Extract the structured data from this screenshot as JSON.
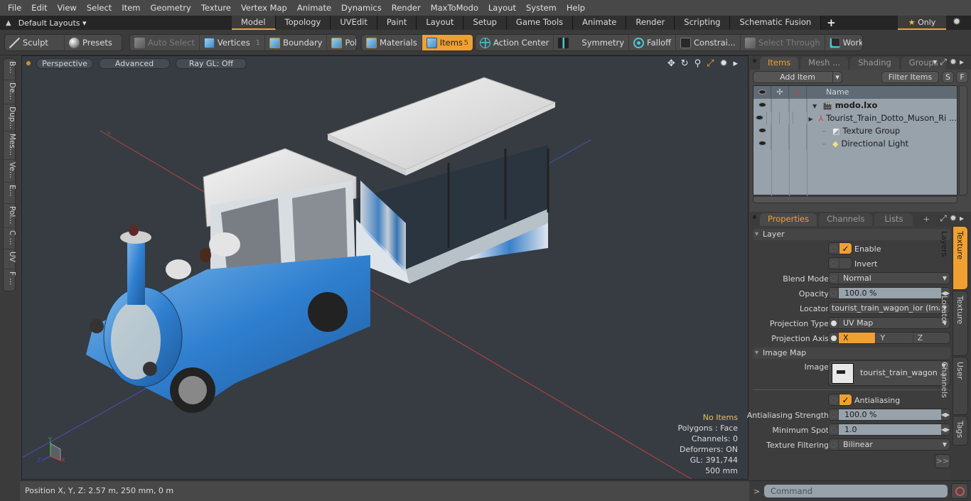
{
  "menu": [
    "File",
    "Edit",
    "View",
    "Select",
    "Item",
    "Geometry",
    "Texture",
    "Vertex Map",
    "Animate",
    "Dynamics",
    "Render",
    "MaxToModo",
    "Layout",
    "System",
    "Help"
  ],
  "layouts": {
    "dropdown_label": "Default Layouts ▾",
    "tabs": [
      "Model",
      "Topology",
      "UVEdit",
      "Paint",
      "Layout",
      "Setup",
      "Game Tools",
      "Animate",
      "Render",
      "Scripting",
      "Schematic Fusion"
    ],
    "active_tab": "Model",
    "add_tab_label": "+",
    "only_label": "Only"
  },
  "toolbar": {
    "sculpt": "Sculpt",
    "presets": "Presets",
    "auto_select": "Auto Select",
    "vertices": "Vertices",
    "vertices_count": "1",
    "boundary": "Boundary",
    "polygons": "Polygons",
    "materials": "Materials",
    "items": "Items",
    "items_count": "5",
    "action_center": "Action Center",
    "symmetry": "Symmetry",
    "falloff": "Falloff",
    "constraints": "Constrai...",
    "select_through": "Select Through",
    "workplane": "WorkPlane"
  },
  "left_tools": [
    "B...",
    "De...",
    "Dup...",
    "Mes...",
    "Ve...",
    "E...",
    "Pol...",
    "C ...",
    "UV",
    "F ..."
  ],
  "viewport": {
    "view_mode": "Perspective",
    "shading": "Advanced",
    "raygl": "Ray GL: Off",
    "info": {
      "selection": "No Items",
      "polygons": "Polygons : Face",
      "channels": "Channels: 0",
      "deformers": "Deformers: ON",
      "gl": "GL: 391,744",
      "scale": "500 mm"
    },
    "axis_labels": {
      "x": "X",
      "y": "Y",
      "z": "Z"
    }
  },
  "status": {
    "position": "Position X, Y, Z:   2.57 m, 250 mm, 0 m"
  },
  "items_panel": {
    "tabs": [
      "Items",
      "Mesh ...",
      "Shading",
      "Groups"
    ],
    "active_tab": "Items",
    "add_item": "Add Item",
    "filter_items": "Filter Items",
    "s_btn": "S",
    "f_btn": "F",
    "name_header": "Name",
    "tree": [
      {
        "name": "modo.lxo",
        "level": 0,
        "icon": "scene-icon",
        "bold": true,
        "expander": "▼"
      },
      {
        "name": "Tourist_Train_Dotto_Muson_Ri ...",
        "level": 1,
        "icon": "locator-icon",
        "bold": false,
        "expander": "▶"
      },
      {
        "name": "Texture Group",
        "level": 1,
        "icon": "texture-group-icon",
        "bold": false,
        "expander": ""
      },
      {
        "name": "Directional Light",
        "level": 1,
        "icon": "light-icon",
        "bold": false,
        "expander": ""
      }
    ]
  },
  "props_panel": {
    "tabs": [
      "Properties",
      "Channels",
      "Lists"
    ],
    "active_tab": "Properties",
    "add_tab": "+",
    "side_tabs": [
      "Texture Layers",
      "Texture Locator",
      "User Channels",
      "Tags"
    ],
    "active_side_tab": "Texture Layers",
    "layer_section": "Layer",
    "enable_label": "Enable",
    "enable_checked": true,
    "invert_label": "Invert",
    "invert_checked": false,
    "blend_mode_label": "Blend Mode",
    "blend_mode": "Normal",
    "opacity_label": "Opacity",
    "opacity": "100.0 %",
    "locator_label": "Locator",
    "locator": "tourist_train_wagon_ior (Ima ...",
    "projection_type_label": "Projection Type",
    "projection_type": "UV Map",
    "projection_axis_label": "Projection Axis",
    "projection_axes": [
      "X",
      "Y",
      "Z"
    ],
    "projection_axis": "X",
    "image_map_section": "Image Map",
    "image_label": "Image",
    "image": "tourist_train_wagon ...",
    "antialiasing_label": "Antialiasing",
    "antialiasing_checked": true,
    "aa_strength_label": "Antialiasing Strength",
    "aa_strength": "100.0 %",
    "min_spot_label": "Minimum Spot",
    "min_spot": "1.0",
    "tex_filter_label": "Texture Filtering",
    "tex_filter": "Bilinear",
    "more_btn": ">>"
  },
  "command": {
    "prompt": ">",
    "placeholder": "Command"
  }
}
